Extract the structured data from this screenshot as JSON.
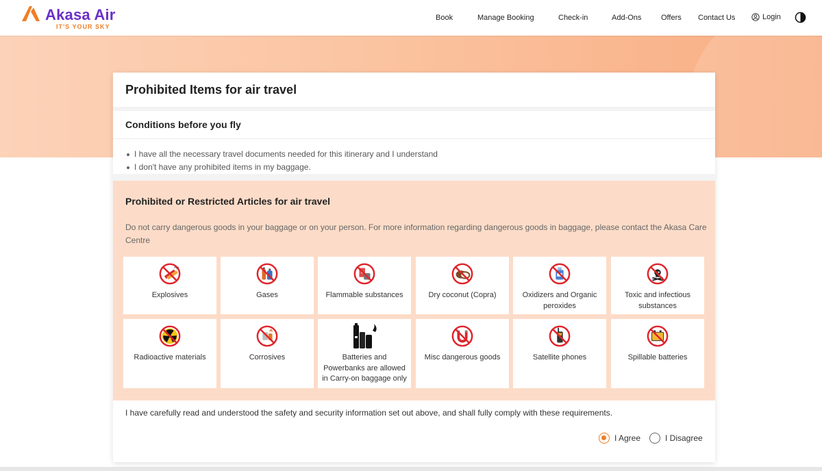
{
  "header": {
    "brand_name": "Akasa Air",
    "brand_tagline": "IT'S YOUR SKY",
    "nav": [
      "Book",
      "Manage Booking",
      "Check-in",
      "Add-Ons",
      "Offers",
      "Contact Us"
    ],
    "login_label": "Login"
  },
  "colors": {
    "brand_purple": "#6b2fc9",
    "brand_orange": "#f07e26",
    "panel_peach": "#fcdcc8",
    "prohibition_red": "#e0232a"
  },
  "card": {
    "title": "Prohibited Items for air travel",
    "conditions_title": "Conditions before you fly",
    "conditions": [
      "I have all the necessary travel documents needed for this itinerary and I understand",
      "I don't have any prohibited items in my baggage."
    ],
    "restricted_title": "Prohibited or Restricted Articles for air travel",
    "restricted_desc": "Do not carry dangerous goods in your baggage or on your person. For more information regarding dangerous goods in baggage, please contact the Akasa Care Centre",
    "items": [
      {
        "label": "Explosives",
        "icon": "explosives-icon"
      },
      {
        "label": "Gases",
        "icon": "gases-icon"
      },
      {
        "label": "Flammable substances",
        "icon": "flammable-icon"
      },
      {
        "label": "Dry coconut (Copra)",
        "icon": "coconut-icon"
      },
      {
        "label": "Oxidizers and Organic peroxides",
        "icon": "oxidizers-icon"
      },
      {
        "label": "Toxic and infectious substances",
        "icon": "toxic-icon"
      },
      {
        "label": "Radioactive materials",
        "icon": "radioactive-icon"
      },
      {
        "label": "Corrosives",
        "icon": "corrosives-icon"
      },
      {
        "label": "Batteries and Powerbanks are allowed in Carry-on baggage only",
        "icon": "batteries-icon"
      },
      {
        "label": "Misc dangerous goods",
        "icon": "magnet-icon"
      },
      {
        "label": "Satellite phones",
        "icon": "satellite-phone-icon"
      },
      {
        "label": "Spillable batteries",
        "icon": "spillable-battery-icon"
      }
    ],
    "agreement_text": "I have carefully read and understood the safety and security information set out above, and shall fully comply with these requirements.",
    "agree_label": "I Agree",
    "disagree_label": "I Disagree",
    "selected": "I Agree"
  }
}
